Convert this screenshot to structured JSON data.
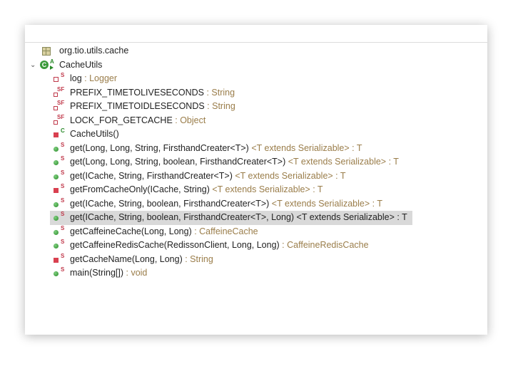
{
  "package": "org.tio.utils.cache",
  "class": {
    "name": "CacheUtils",
    "modifiers": "A"
  },
  "members": [
    {
      "icon": "private-field-icon",
      "mod": "S",
      "name": "log",
      "suffix": " : Logger"
    },
    {
      "icon": "private-static-final-field-icon",
      "mod": "SF",
      "name": "PREFIX_TIMETOLIVESECONDS",
      "suffix": " : String"
    },
    {
      "icon": "private-static-final-field-icon",
      "mod": "SF",
      "name": "PREFIX_TIMETOIDLESECONDS",
      "suffix": " : String"
    },
    {
      "icon": "private-static-final-field-icon",
      "mod": "SF",
      "name": "LOCK_FOR_GETCACHE",
      "suffix": " : Object"
    },
    {
      "icon": "private-constructor-icon",
      "mod": "C",
      "name": "CacheUtils()",
      "suffix": ""
    },
    {
      "icon": "public-method-icon",
      "mod": "S",
      "name": "get(Long, Long, String, FirsthandCreater<T>)",
      "suffix": " <T extends Serializable> : T"
    },
    {
      "icon": "public-method-icon",
      "mod": "S",
      "name": "get(Long, Long, String, boolean, FirsthandCreater<T>)",
      "suffix": " <T extends Serializable> : T"
    },
    {
      "icon": "public-method-icon",
      "mod": "S",
      "name": "get(ICache, String, FirsthandCreater<T>)",
      "suffix": " <T extends Serializable> : T"
    },
    {
      "icon": "private-method-icon",
      "mod": "S",
      "name": "getFromCacheOnly(ICache, String)",
      "suffix": " <T extends Serializable> : T"
    },
    {
      "icon": "public-method-icon",
      "mod": "S",
      "name": "get(ICache, String, boolean, FirsthandCreater<T>)",
      "suffix": " <T extends Serializable> : T"
    },
    {
      "icon": "public-method-icon",
      "mod": "S",
      "name": "get(ICache, String, boolean, FirsthandCreater<T>, Long)",
      "suffix": " <T extends Serializable> : T",
      "selected": true
    },
    {
      "icon": "public-method-icon",
      "mod": "S",
      "name": "getCaffeineCache(Long, Long)",
      "suffix": " : CaffeineCache"
    },
    {
      "icon": "public-method-icon",
      "mod": "S",
      "name": "getCaffeineRedisCache(RedissonClient, Long, Long)",
      "suffix": " : CaffeineRedisCache"
    },
    {
      "icon": "private-method-icon",
      "mod": "S",
      "name": "getCacheName(Long, Long)",
      "suffix": " : String"
    },
    {
      "icon": "public-method-icon",
      "mod": "S",
      "name": "main(String[])",
      "suffix": " : void"
    }
  ]
}
